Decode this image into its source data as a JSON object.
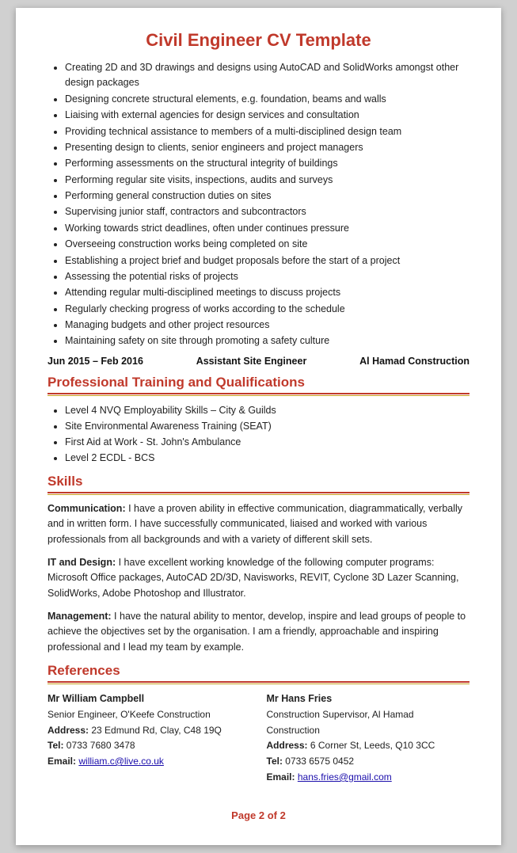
{
  "title": "Civil Engineer CV Template",
  "experience_bullets": [
    "Creating 2D and 3D drawings and designs using AutoCAD and SolidWorks amongst other design packages",
    "Designing concrete structural elements, e.g. foundation, beams and walls",
    "Liaising with external agencies for design services and consultation",
    "Providing technical assistance to members of a multi-disciplined design team",
    "Presenting design to clients, senior engineers and project managers",
    "Performing assessments on the structural integrity of buildings",
    "Performing regular site visits, inspections, audits and surveys",
    "Performing general construction duties on sites",
    "Supervising junior staff, contractors and subcontractors",
    "Working towards strict deadlines, often under continues pressure",
    "Overseeing construction works being completed on site",
    "Establishing a project brief and budget proposals before the start of a project",
    "Assessing the potential risks of projects",
    "Attending regular multi-disciplined meetings to discuss projects",
    "Regularly checking progress of works according to the schedule",
    "Managing budgets and other project resources",
    "Maintaining safety on site through promoting a safety culture"
  ],
  "job_date": "Jun 2015 – Feb 2016",
  "job_title": "Assistant Site Engineer",
  "job_company": "Al Hamad Construction",
  "training_section_title": "Professional Training and Qualifications",
  "training_bullets": [
    "Level 4 NVQ Employability Skills – City & Guilds",
    "Site Environmental Awareness Training (SEAT)",
    "First Aid at Work - St. John's Ambulance",
    "Level 2 ECDL - BCS"
  ],
  "skills_section_title": "Skills",
  "skills": [
    {
      "label": "Communication:",
      "text": " I have a proven ability in effective communication, diagrammatically, verbally and in written form. I have successfully communicated, liaised and worked with various professionals from all backgrounds and with a variety of different skill sets."
    },
    {
      "label": "IT and Design:",
      "text": " I have excellent working knowledge of the following computer programs: Microsoft Office packages, AutoCAD 2D/3D, Navisworks, REVIT, Cyclone 3D Lazer Scanning, SolidWorks, Adobe Photoshop and Illustrator."
    },
    {
      "label": "Management:",
      "text": " I have the natural ability to mentor, develop, inspire and lead groups of people to achieve the objectives set by the organisation.  I am a friendly, approachable and inspiring professional and I lead my team by example."
    }
  ],
  "references_section_title": "References",
  "ref1": {
    "name": "Mr William Campbell",
    "title": "Senior Engineer, O'Keefe Construction",
    "address_label": "Address:",
    "address": "23 Edmund Rd, Clay, C48 19Q",
    "tel_label": "Tel:",
    "tel": "0733 7680 3478",
    "email_label": "Email:",
    "email": "william.c@live.co.uk"
  },
  "ref2": {
    "name": "Mr Hans Fries",
    "title": "Construction Supervisor, Al Hamad Construction",
    "address_label": "Address:",
    "address": "6 Corner St, Leeds, Q10 3CC",
    "tel_label": "Tel:",
    "tel": "0733 6575 0452",
    "email_label": "Email:",
    "email": "hans.fries@gmail.com"
  },
  "page_number": "Page 2 of 2"
}
